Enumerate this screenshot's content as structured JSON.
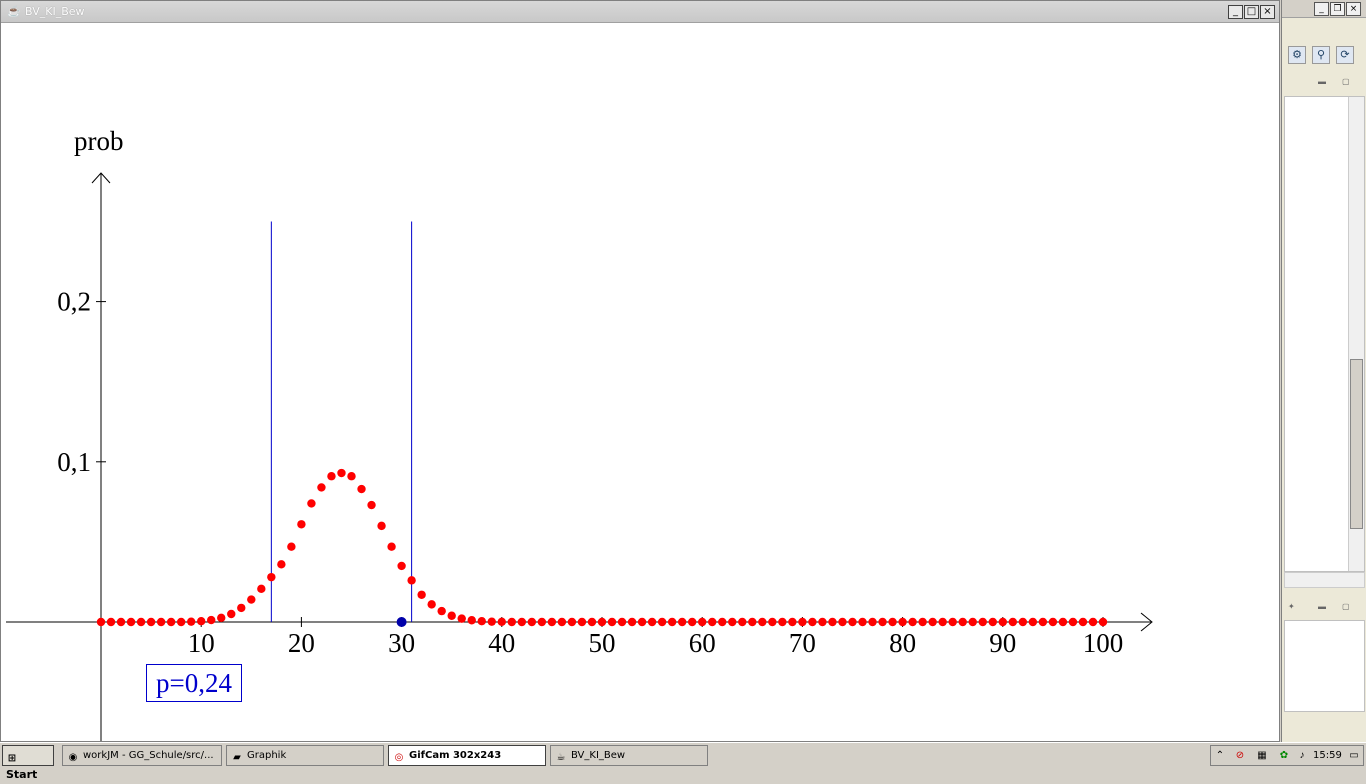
{
  "window": {
    "title": "BV_KI_Bew",
    "min": "_",
    "max": "□",
    "close": "×"
  },
  "chart_data": {
    "type": "scatter",
    "ylabel": "prob",
    "xlim": [
      0,
      100
    ],
    "ylim": [
      0,
      0.25
    ],
    "x_ticks": [
      10,
      20,
      30,
      40,
      50,
      60,
      70,
      80,
      90,
      100
    ],
    "x_tick_labels": [
      "10",
      "20",
      "30",
      "40",
      "50",
      "60",
      "70",
      "80",
      "90",
      "100"
    ],
    "y_ticks": [
      0.1,
      0.2
    ],
    "y_tick_labels": [
      "0,1",
      "0,2"
    ],
    "vertical_lines": [
      17,
      31
    ],
    "marker": 30,
    "series": [
      {
        "x": [
          0,
          1,
          2,
          3,
          4,
          5,
          6,
          7,
          8,
          9,
          10,
          11,
          12,
          13,
          14,
          15,
          16,
          17,
          18,
          19,
          20,
          21,
          22,
          23,
          24,
          25,
          26,
          27,
          28,
          29,
          30,
          31,
          32,
          33,
          34,
          35,
          36,
          37,
          38,
          39,
          40,
          41,
          42,
          43,
          44,
          45,
          46,
          47,
          48,
          49,
          50,
          51,
          52,
          53,
          54,
          55,
          56,
          57,
          58,
          59,
          60,
          61,
          62,
          63,
          64,
          65,
          66,
          67,
          68,
          69,
          70,
          71,
          72,
          73,
          74,
          75,
          76,
          77,
          78,
          79,
          80,
          81,
          82,
          83,
          84,
          85,
          86,
          87,
          88,
          89,
          90,
          91,
          92,
          93,
          94,
          95,
          96,
          97,
          98,
          99,
          100
        ],
        "values": [
          0,
          0,
          0,
          0,
          0,
          0,
          0,
          0,
          0,
          0.0002,
          0.0005,
          0.0012,
          0.0026,
          0.005,
          0.0088,
          0.014,
          0.0207,
          0.028,
          0.036,
          0.047,
          0.061,
          0.074,
          0.084,
          0.091,
          0.093,
          0.091,
          0.083,
          0.073,
          0.06,
          0.047,
          0.035,
          0.026,
          0.017,
          0.011,
          0.0068,
          0.0039,
          0.0021,
          0.0011,
          0.0005,
          0.0002,
          0.0001,
          0,
          0,
          0,
          0,
          0,
          0,
          0,
          0,
          0,
          0,
          0,
          0,
          0,
          0,
          0,
          0,
          0,
          0,
          0,
          0,
          0,
          0,
          0,
          0,
          0,
          0,
          0,
          0,
          0,
          0,
          0,
          0,
          0,
          0,
          0,
          0,
          0,
          0,
          0,
          0,
          0,
          0,
          0,
          0,
          0,
          0,
          0,
          0,
          0,
          0,
          0,
          0,
          0,
          0,
          0,
          0,
          0,
          0,
          0,
          0
        ]
      }
    ]
  },
  "p_label": "p=0,24",
  "right_panel": {
    "min": "_",
    "restore": "❐",
    "close": "×"
  },
  "taskbar": {
    "start": "Start",
    "tasks": [
      "workJM - GG_Schule/src/...",
      "Graphik",
      "GifCam 302x243",
      "BV_KI_Bew"
    ],
    "clock": "15:59"
  },
  "colors": {
    "dot": "#ff0000",
    "line": "#0000cc",
    "marker": "#0000aa"
  }
}
